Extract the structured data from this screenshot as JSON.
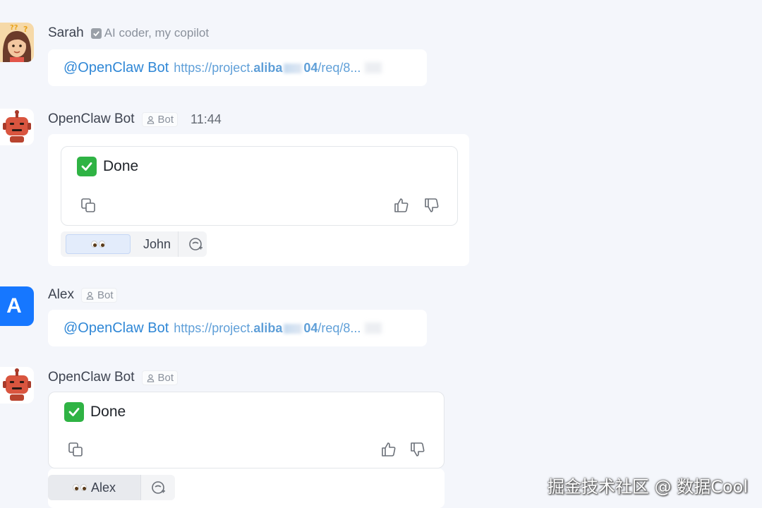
{
  "messages": [
    {
      "sender": "Sarah",
      "tag_label": "AI coder, my copilot",
      "mention": "@OpenClaw Bot",
      "link_pre": "https://project.",
      "link_bold": "aliba",
      "link_bold2": "04",
      "link_post": "/req/8..."
    },
    {
      "sender": "OpenClaw Bot",
      "tag_label": "Bot",
      "time": "11:44",
      "result_text": "Done",
      "reaction_user": "John"
    },
    {
      "sender": "Alex",
      "avatar_letter": "A",
      "tag_label": "Bot",
      "mention": "@OpenClaw Bot",
      "link_pre": "https://project.",
      "link_bold": "aliba",
      "link_bold2": "04",
      "link_post": "/req/8..."
    },
    {
      "sender": "OpenClaw Bot",
      "tag_label": "Bot",
      "result_text": "Done",
      "reaction_user": "Alex"
    }
  ],
  "icons": {
    "copy": "copy-icon",
    "thumbs_up": "thumbs-up-icon",
    "thumbs_down": "thumbs-down-icon",
    "add_reaction": "add-reaction-icon",
    "eyes": "eyes-emoji-icon",
    "check": "check-mark-icon",
    "bot": "bot-icon"
  },
  "colors": {
    "mention": "#2f87d6",
    "link": "#5f9fd8",
    "done_check": "#2fb344",
    "avatar_letter_bg": "#1677ff",
    "reaction_highlight": "#e3ecfb"
  },
  "watermark": "掘金技术社区 @ 数据Cool"
}
